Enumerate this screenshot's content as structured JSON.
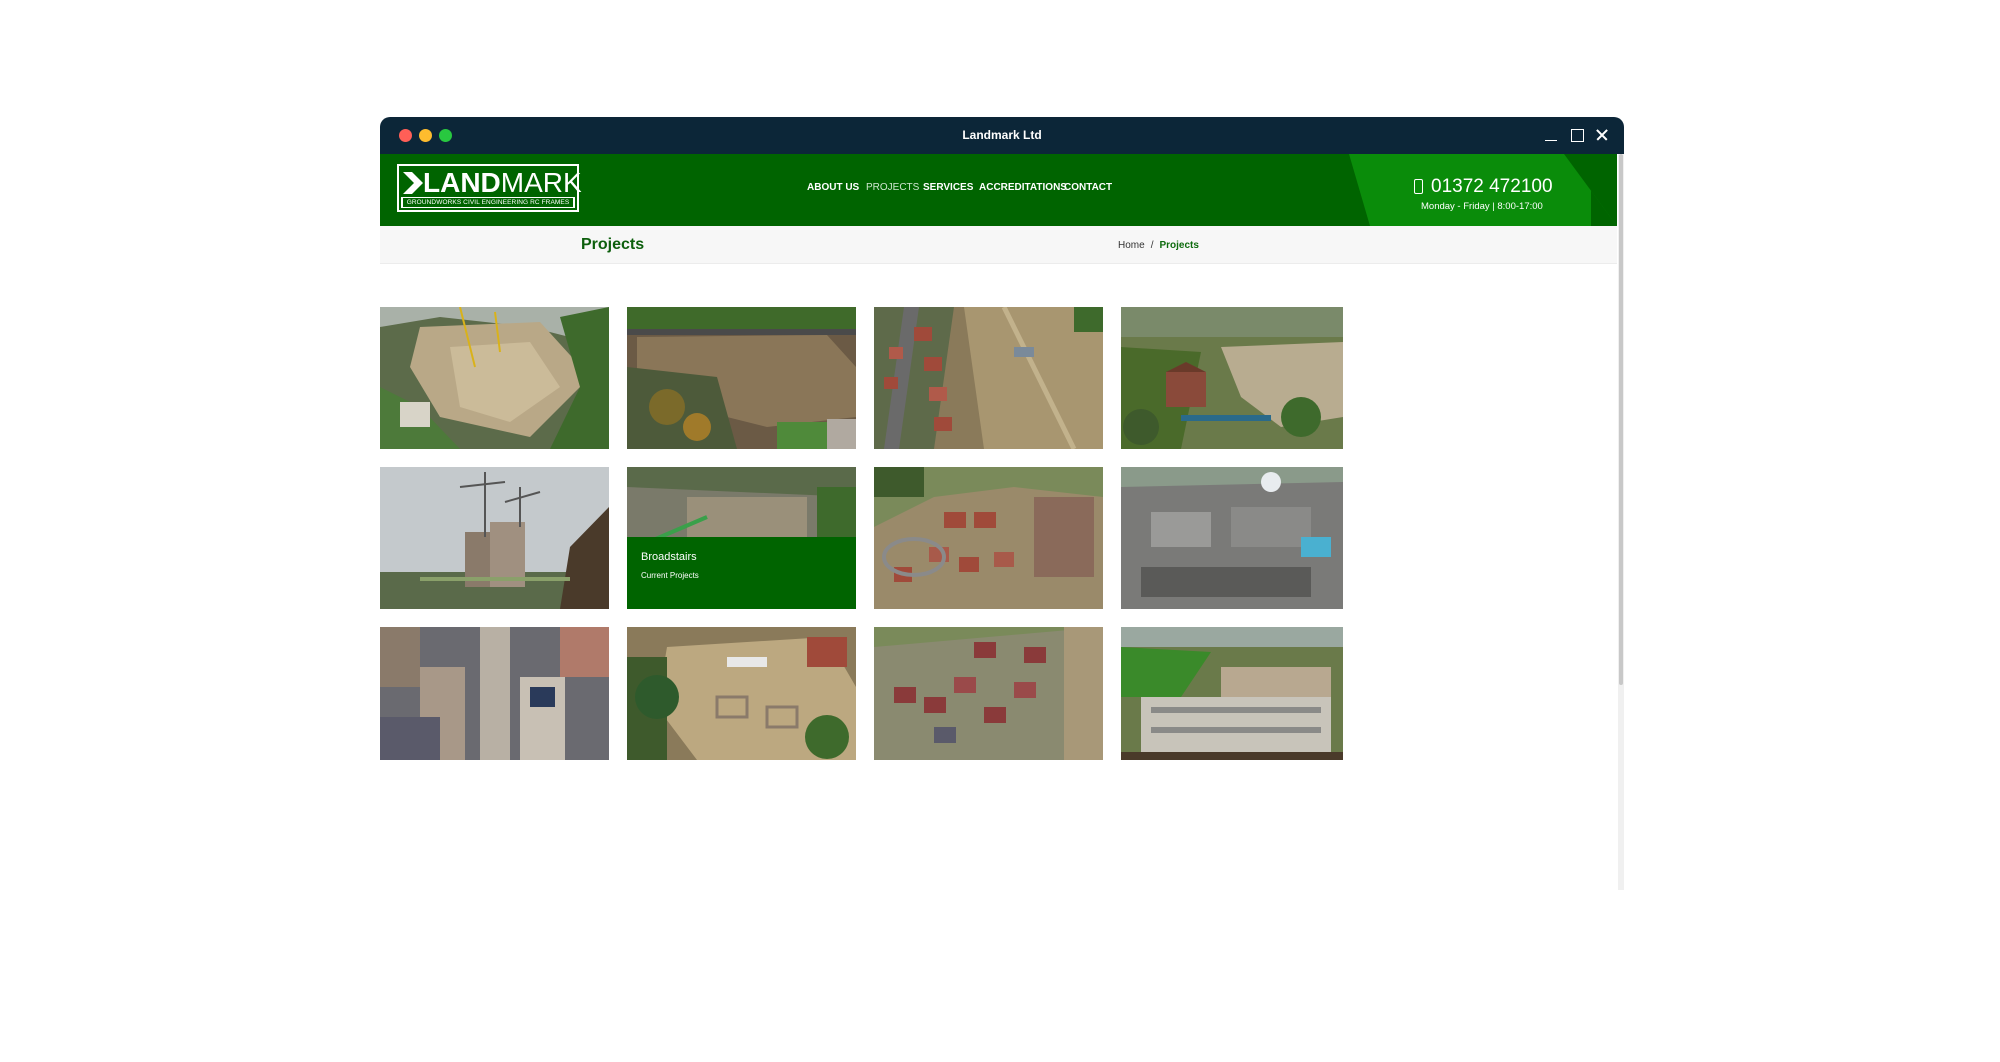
{
  "window": {
    "title": "Landmark Ltd"
  },
  "logo": {
    "main_prefix": "LAND",
    "main_suffix": "MARK",
    "tagline": "GROUNDWORKS   CIVIL ENGINEERING   RC FRAMES"
  },
  "nav": {
    "items": [
      {
        "label": "ABOUT US"
      },
      {
        "label": "PROJECTS"
      },
      {
        "label": "SERVICES"
      },
      {
        "label": "ACCREDITATIONS"
      },
      {
        "label": "CONTACT"
      }
    ],
    "active": "PROJECTS"
  },
  "contact": {
    "phone": "01372 472100",
    "hours": "Monday - Friday | 8:00-17:00"
  },
  "page": {
    "title": "Projects"
  },
  "breadcrumb": {
    "home": "Home",
    "separator": "/",
    "current": "Projects"
  },
  "hover_tile": {
    "title": "Broadstairs",
    "subtitle": "Current Projects"
  },
  "colors": {
    "brand_green": "#006400",
    "accent_green": "#0a8c0a",
    "titlebar": "#0c2638"
  }
}
